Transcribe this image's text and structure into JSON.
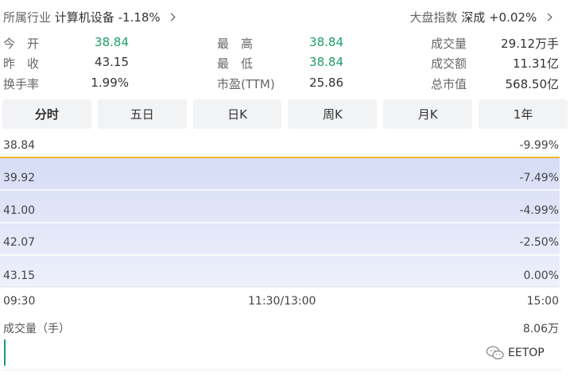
{
  "header": {
    "industry_label": "所属行业",
    "industry_name": "计算机设备",
    "industry_change": "-1.18%",
    "index_label": "大盘指数",
    "index_name": "深成",
    "index_change": "+0.02%"
  },
  "stats": {
    "open_label": "今　开",
    "open_value": "38.84",
    "prev_close_label": "昨　收",
    "prev_close_value": "43.15",
    "turnover_rate_label": "换手率",
    "turnover_rate_value": "1.99%",
    "high_label": "最　高",
    "high_value": "38.84",
    "low_label": "最　低",
    "low_value": "38.84",
    "pe_label": "市盈(TTM)",
    "pe_value": "25.86",
    "volume_label": "成交量",
    "volume_value": "29.12万手",
    "amount_label": "成交额",
    "amount_value": "11.31亿",
    "market_cap_label": "总市值",
    "market_cap_value": "568.50亿"
  },
  "tabs": [
    "分时",
    "五日",
    "日K",
    "周K",
    "月K",
    "1年"
  ],
  "active_tab": "分时",
  "chart": {
    "price_ticks": [
      "38.84",
      "39.92",
      "41.00",
      "42.07",
      "43.15"
    ],
    "pct_ticks": [
      "-9.99%",
      "-7.49%",
      "-4.99%",
      "-2.50%",
      "0.00%"
    ],
    "time_ticks": [
      "09:30",
      "11:30/13:00",
      "15:00"
    ],
    "price_line_value": 38.84,
    "line_color": "#f0b429",
    "fill_color_top": "#d6dcf6",
    "fill_color_bottom": "#eef0fb"
  },
  "volume": {
    "title": "成交量（手）",
    "max_label": "8.06万",
    "bar_color": "#1e9e68"
  },
  "watermark": {
    "text": "EETOP",
    "icon": "wechat-icon"
  }
}
